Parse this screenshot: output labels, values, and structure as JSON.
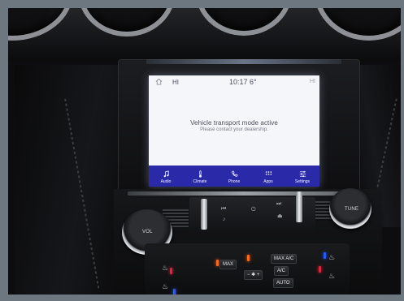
{
  "screen": {
    "status_bar": {
      "home_icon": "home-icon",
      "left_text": "HI",
      "center_text": "10:17  6°",
      "right_text": "HI"
    },
    "message": {
      "title": "Vehicle transport mode active",
      "subtitle": "Please contact your dealership."
    },
    "nav": [
      {
        "label": "Audio",
        "icon": "music-note-icon"
      },
      {
        "label": "Climate",
        "icon": "thermometer-icon"
      },
      {
        "label": "Phone",
        "icon": "phone-icon"
      },
      {
        "label": "Apps",
        "icon": "grid-icon"
      },
      {
        "label": "Settings",
        "icon": "sliders-icon"
      }
    ]
  },
  "console": {
    "vol_label": "VOL",
    "tune_label": "TUNE",
    "climate": {
      "max_heat": "MAX",
      "max_ac": "MAX A/C",
      "ac": "A/C",
      "auto": "AUTO"
    }
  },
  "colors": {
    "nav_bar": "#2a2aa8",
    "screen_bg": "#f4f6fa",
    "led_orange": "#ff6a1a",
    "led_red": "#e0243a",
    "led_blue": "#2a58ff",
    "frame": "#6c7780"
  }
}
